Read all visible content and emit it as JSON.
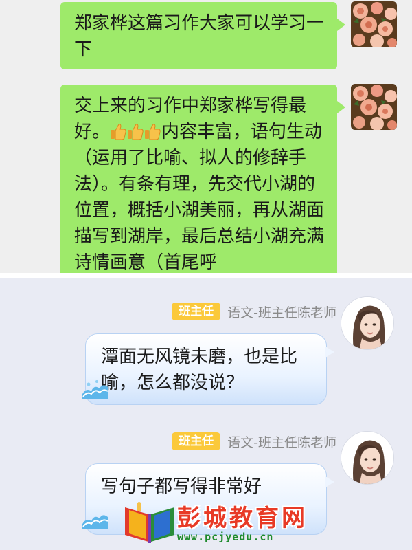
{
  "top_chat": {
    "messages": [
      {
        "text": "郑家桦这篇习作大家可以学习一下"
      },
      {
        "text_before": "交上来的习作中郑家桦写得最好。",
        "text_after": "内容丰富，语句生动（运用了比喻、拟人的修辞手法）。有条有理，先交代小湖的位置，概括小湖美丽，再从湖面描写到湖岸，最后总结小湖充满诗情画意（首尾呼"
      }
    ]
  },
  "bottom_chat": {
    "messages": [
      {
        "badge": "班主任",
        "sender": "语文-班主任陈老师",
        "text": "潭面无风镜未磨，也是比喻，怎么都没说？"
      },
      {
        "badge": "班主任",
        "sender": "语文-班主任陈老师",
        "text": "写句子都写得非常好"
      }
    ]
  },
  "watermark": {
    "title": "彭城教育网",
    "url": "www.pcjyedu.cn"
  },
  "colors": {
    "wechat_bubble": "#9eea6a",
    "qq_bubble_border": "#b8d2f3",
    "badge": "#fbc93a"
  }
}
